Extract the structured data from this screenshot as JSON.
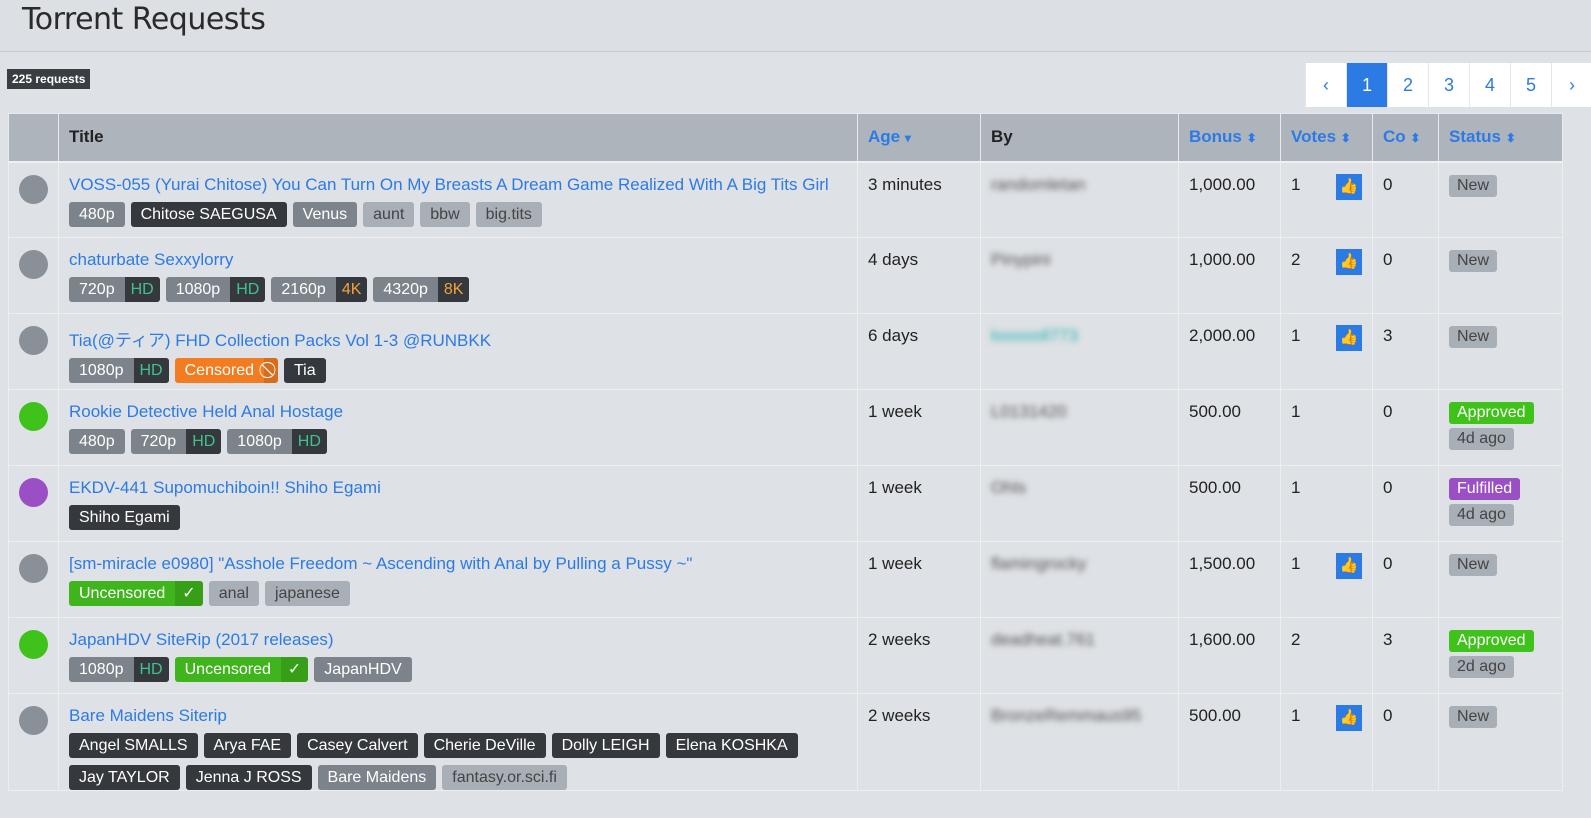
{
  "page_title": "Torrent Requests",
  "count": "225 requests",
  "pagination": {
    "prev": "‹",
    "pages": [
      "1",
      "2",
      "3",
      "4",
      "5"
    ],
    "active": "1",
    "next": "›"
  },
  "columns": {
    "title": "Title",
    "age": "Age",
    "by": "By",
    "bonus": "Bonus",
    "votes": "Votes",
    "co": "Co",
    "status": "Status"
  },
  "sort_icons": {
    "age": "▾",
    "other": "⬍"
  },
  "rows": [
    {
      "dot": "grey",
      "title": "VOSS-055 (Yurai Chitose) You Can Turn On My Breasts A Dream Game Realized With A Big Tits Girl",
      "tags": [
        {
          "t": "480p",
          "c": "t-grey"
        },
        {
          "t": "Chitose SAEGUSA",
          "c": "t-dark"
        },
        {
          "t": "Venus",
          "c": "t-grey"
        },
        {
          "t": "aunt",
          "c": "t-light"
        },
        {
          "t": "bbw",
          "c": "t-light"
        },
        {
          "t": "big.tits",
          "c": "t-light"
        }
      ],
      "age": "3 minutes",
      "by": "randomletan",
      "bonus": "1,000.00",
      "votes": "1",
      "like": true,
      "co": "0",
      "status": "New"
    },
    {
      "dot": "grey",
      "title": "chaturbate Sexxylorry",
      "tags": [
        {
          "t": "720p",
          "c": "t-grey",
          "s": "HD",
          "sc": "hd"
        },
        {
          "t": "1080p",
          "c": "t-grey",
          "s": "HD",
          "sc": "hd"
        },
        {
          "t": "2160p",
          "c": "t-grey",
          "s": "4K",
          "sc": "k4"
        },
        {
          "t": "4320p",
          "c": "t-grey",
          "s": "8K",
          "sc": "k4"
        }
      ],
      "age": "4 days",
      "by": "Pinypini",
      "bonus": "1,000.00",
      "votes": "2",
      "like": true,
      "co": "0",
      "status": "New"
    },
    {
      "dot": "grey",
      "title": "Tia(@ティア) FHD Collection Packs Vol 1-3 @RUNBKK",
      "tags": [
        {
          "t": "1080p",
          "c": "t-grey",
          "s": "HD",
          "sc": "hd"
        },
        {
          "t": "Censored",
          "c": "t-or",
          "s": "⃠",
          "sc": "sub2x"
        },
        {
          "t": "Tia",
          "c": "t-dark"
        }
      ],
      "age": "6 days",
      "by": "loooooll773",
      "by_teal": true,
      "bonus": "2,000.00",
      "votes": "1",
      "like": true,
      "co": "3",
      "status": "New"
    },
    {
      "dot": "green",
      "title": "Rookie Detective Held Anal Hostage",
      "tags": [
        {
          "t": "480p",
          "c": "t-grey"
        },
        {
          "t": "720p",
          "c": "t-grey",
          "s": "HD",
          "sc": "hd"
        },
        {
          "t": "1080p",
          "c": "t-grey",
          "s": "HD",
          "sc": "hd"
        }
      ],
      "age": "1 week",
      "by": "L0131420",
      "bonus": "500.00",
      "votes": "1",
      "like": false,
      "co": "0",
      "status": "Approved",
      "ago": "4d ago"
    },
    {
      "dot": "purple",
      "title": "EKDV-441 Supomuchiboin!! Shiho Egami",
      "tags": [
        {
          "t": "Shiho Egami",
          "c": "t-dark"
        }
      ],
      "age": "1 week",
      "by": "Ohls",
      "bonus": "500.00",
      "votes": "1",
      "like": false,
      "co": "0",
      "status": "Fulfilled",
      "ago": "4d ago"
    },
    {
      "dot": "grey",
      "title": "[sm-miracle e0980] \"Asshole Freedom ~ Ascending with Anal by Pulling a Pussy ~\"",
      "tags": [
        {
          "t": "Uncensored",
          "c": "t-gr",
          "s": "✓",
          "sc": "sub2x"
        },
        {
          "t": "anal",
          "c": "t-light"
        },
        {
          "t": "japanese",
          "c": "t-light"
        }
      ],
      "age": "1 week",
      "by": "flamingrocky",
      "bonus": "1,500.00",
      "votes": "1",
      "like": true,
      "co": "0",
      "status": "New"
    },
    {
      "dot": "green",
      "title": "JapanHDV SiteRip (2017 releases)",
      "tags": [
        {
          "t": "1080p",
          "c": "t-grey",
          "s": "HD",
          "sc": "hd"
        },
        {
          "t": "Uncensored",
          "c": "t-gr",
          "s": "✓",
          "sc": "sub2x"
        },
        {
          "t": "JapanHDV",
          "c": "t-grey"
        }
      ],
      "age": "2 weeks",
      "by": "deadheat.761",
      "bonus": "1,600.00",
      "votes": "2",
      "like": false,
      "co": "3",
      "status": "Approved",
      "ago": "2d ago"
    },
    {
      "dot": "grey",
      "title": "Bare Maidens Siterip",
      "tags": [
        {
          "t": "Angel SMALLS",
          "c": "t-dark"
        },
        {
          "t": "Arya FAE",
          "c": "t-dark"
        },
        {
          "t": "Casey Calvert",
          "c": "t-dark"
        },
        {
          "t": "Cherie DeVille",
          "c": "t-dark"
        },
        {
          "t": "Dolly LEIGH",
          "c": "t-dark"
        },
        {
          "t": "Elena KOSHKA",
          "c": "t-dark"
        },
        {
          "t": "Jay TAYLOR",
          "c": "t-dark"
        },
        {
          "t": "Jenna J ROSS",
          "c": "t-dark"
        },
        {
          "t": "Bare Maidens",
          "c": "t-grey"
        },
        {
          "t": "fantasy.or.sci.fi",
          "c": "t-light"
        }
      ],
      "age": "2 weeks",
      "by": "BronzeRemmaus95",
      "bonus": "500.00",
      "votes": "1",
      "like": true,
      "co": "0",
      "status": "New"
    }
  ]
}
